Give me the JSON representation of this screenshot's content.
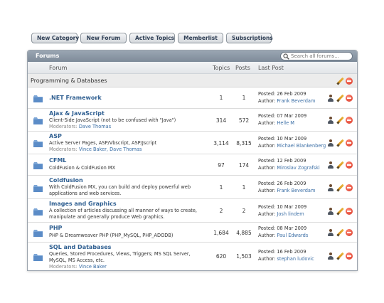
{
  "toolbar": {
    "new_category": "New Category",
    "new_forum": "New Forum",
    "active_topics": "Active Topics",
    "memberlist": "Memberlist",
    "subscriptions": "Subscriptions"
  },
  "panel": {
    "title": "Forums",
    "search_placeholder": "Search all forums..."
  },
  "columns": {
    "forum": "Forum",
    "topics": "Topics",
    "posts": "Posts",
    "last_post": "Last Post"
  },
  "category": {
    "name": "Programming & Databases"
  },
  "forums": [
    {
      "name": ".NET Framework",
      "desc": "",
      "moderators": "",
      "topics": "1",
      "posts": "1",
      "posted": "Posted: 26 Feb 2009",
      "author": "Frank Beverdam"
    },
    {
      "name": "Ajax & JavaScript",
      "desc": "Client-Side JavaScript (not to be confused with \"Java\")",
      "moderators": "Dave Thomas",
      "topics": "314",
      "posts": "572",
      "posted": "Posted: 07 Mar 2009",
      "author": "Helle M"
    },
    {
      "name": "ASP",
      "desc": "Active Server Pages, ASP/Vbscript, ASP/Jscript",
      "moderators": "Vince Baker, Dave Thomas",
      "topics": "3,114",
      "posts": "8,315",
      "posted": "Posted: 10 Mar 2009",
      "author": "Michael Blankenberg"
    },
    {
      "name": "CFML",
      "desc": "ColdFusion & ColdFusion MX",
      "moderators": "",
      "topics": "97",
      "posts": "174",
      "posted": "Posted: 12 Feb 2009",
      "author": "Miroslav Zografski"
    },
    {
      "name": "Coldfusion",
      "desc": "With ColdFusion MX, you can build and deploy powerful web applications and web services.",
      "moderators": "",
      "topics": "1",
      "posts": "1",
      "posted": "Posted: 26 Feb 2009",
      "author": "Frank Beverdam"
    },
    {
      "name": "Images and Graphics",
      "desc": "A collection of articles discussing all manner of ways to create, manipulate and generally produce Web graphics.",
      "moderators": "",
      "topics": "2",
      "posts": "2",
      "posted": "Posted: 10 Mar 2009",
      "author": "Josh lindem"
    },
    {
      "name": "PHP",
      "desc": "PHP & Dreamweaver PHP (PHP_MySQL, PHP_ADODB)",
      "moderators": "",
      "topics": "1,684",
      "posts": "4,885",
      "posted": "Posted: 08 Mar 2009",
      "author": "Paul Edwards"
    },
    {
      "name": "SQL and Databases",
      "desc": "Queries, Stored Procedures, Views, Triggers; MS SQL Server, MySQL, MS Access, etc.",
      "moderators": "Vince Baker",
      "topics": "620",
      "posts": "1,503",
      "posted": "Posted: 16 Feb 2009",
      "author": "stephan ludovic"
    }
  ],
  "labels": {
    "moderators": "Moderators:",
    "author": "Author:"
  },
  "colors": {
    "header": "#8a96a4",
    "link": "#2f5f91",
    "delete": "#d7301e"
  },
  "icons": [
    "search-icon",
    "folder-icon",
    "user-icon",
    "edit-icon",
    "delete-icon"
  ]
}
